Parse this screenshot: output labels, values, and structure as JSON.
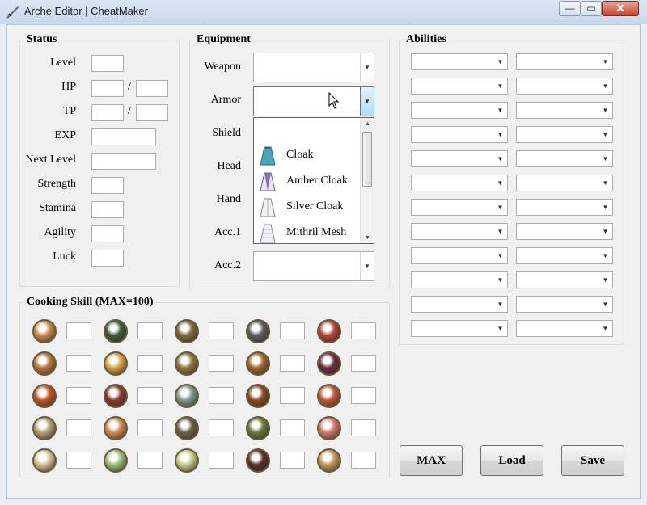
{
  "window": {
    "title": "Arche Editor | CheatMaker",
    "close_glyph": "✕",
    "minimize_glyph": "—",
    "maximize_glyph": "▭"
  },
  "status": {
    "title": "Status",
    "labels": [
      "Level",
      "HP",
      "TP",
      "EXP",
      "Next Level",
      "Strength",
      "Stamina",
      "Agility",
      "Luck"
    ],
    "slash": "/"
  },
  "equipment": {
    "title": "Equipment",
    "slots": [
      "Weapon",
      "Armor",
      "Shield",
      "Head",
      "Hand",
      "Acc.1",
      "Acc.2"
    ]
  },
  "armor_dropdown": {
    "items": [
      {
        "label": "Cloak",
        "icon": "cloak-icon",
        "color": "#4aa6b8"
      },
      {
        "label": "Amber Cloak",
        "icon": "amber-cloak-icon",
        "color": "#8a6fb0"
      },
      {
        "label": "Silver Cloak",
        "icon": "silver-cloak-icon",
        "color": "#a8b2b8"
      },
      {
        "label": "Mithril Mesh",
        "icon": "mithril-mesh-icon",
        "color": "#c7b9d9"
      }
    ]
  },
  "abilities": {
    "title": "Abilities",
    "rows": 12
  },
  "cooking": {
    "title": "Cooking  Skill (MAX=100)",
    "rows": [
      [
        {
          "icon": "burger-bun-icon",
          "color": "#c98b4e"
        },
        {
          "icon": "onigiri-icon",
          "color": "#3f5b3a"
        },
        {
          "icon": "soup-bowl-icon",
          "color": "#7b6a3f"
        },
        {
          "icon": "parfait-cup-icon",
          "color": "#5d5d5d"
        },
        {
          "icon": "sausage-plate-icon",
          "color": "#b5443a"
        }
      ],
      [
        {
          "icon": "hamburger-icon",
          "color": "#b9793b"
        },
        {
          "icon": "omelette-icon",
          "color": "#d9a642"
        },
        {
          "icon": "sandwich-icon",
          "color": "#8f7a3e"
        },
        {
          "icon": "curry-plate-icon",
          "color": "#a4652d"
        },
        {
          "icon": "berry-bowl-icon",
          "color": "#6b2b3a"
        }
      ],
      [
        {
          "icon": "drink-glass-icon",
          "color": "#c0562c"
        },
        {
          "icon": "grilled-meat-icon",
          "color": "#8a3b2a"
        },
        {
          "icon": "salad-dish-icon",
          "color": "#7f9a8e"
        },
        {
          "icon": "stew-pot-icon",
          "color": "#8e4a1f"
        },
        {
          "icon": "fish-plate-icon",
          "color": "#c05a3a"
        }
      ],
      [
        {
          "icon": "porridge-icon",
          "color": "#b6a179"
        },
        {
          "icon": "noodle-bowl-icon",
          "color": "#d08e55"
        },
        {
          "icon": "hotpot-icon",
          "color": "#6d6048"
        },
        {
          "icon": "soup-plate-icon",
          "color": "#6a7a3a"
        },
        {
          "icon": "dessert-cup-icon",
          "color": "#d97a6a"
        }
      ],
      [
        {
          "icon": "rice-bowl-icon",
          "color": "#d8c39a"
        },
        {
          "icon": "vegetable-soup-icon",
          "color": "#9bbf7a"
        },
        {
          "icon": "pasta-plate-icon",
          "color": "#c7cf8a"
        },
        {
          "icon": "cake-slice-icon",
          "color": "#5a2f22"
        },
        {
          "icon": "clam-soup-icon",
          "color": "#c49a5a"
        }
      ]
    ]
  },
  "buttons": {
    "max": "MAX",
    "load": "Load",
    "save": "Save"
  },
  "colors": {
    "accent_focus": "#3c7fb1",
    "close_button": "#c7432c"
  }
}
